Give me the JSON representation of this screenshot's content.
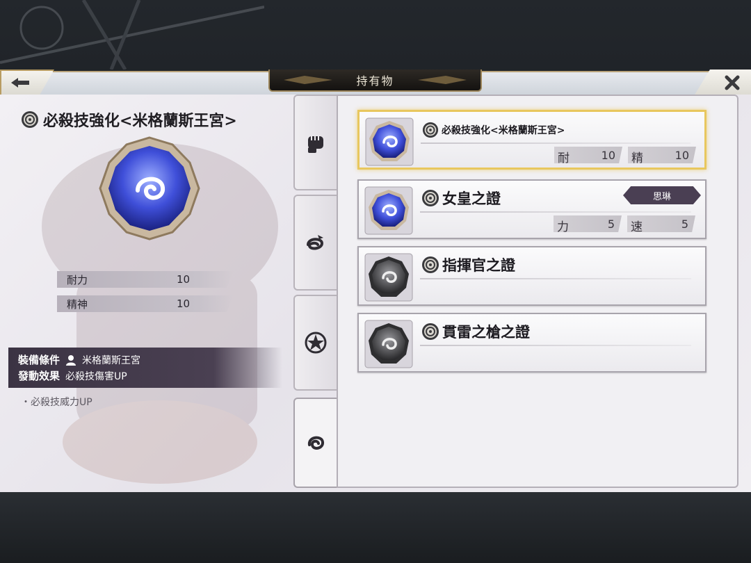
{
  "header": {
    "back_icon": "left-arrow-icon",
    "title": "持有物",
    "close_icon": "close-icon"
  },
  "detail": {
    "name": "必殺技強化<米格蘭斯王宮>",
    "gem_color": "#3f4fd9",
    "stats": [
      {
        "label": "耐力",
        "value": "10"
      },
      {
        "label": "精神",
        "value": "10"
      }
    ],
    "equip_condition_label": "裝備條件",
    "equip_condition_value": "米格蘭斯王宮",
    "effect_label": "發動效果",
    "effect_value": "必殺技傷害UP",
    "passive": "・必殺技威力UP"
  },
  "tabs": [
    {
      "icon": "fist-icon"
    },
    {
      "icon": "dragon-icon"
    },
    {
      "icon": "star-crest-icon"
    },
    {
      "icon": "swirl-icon",
      "active": true
    }
  ],
  "items": [
    {
      "name": "必殺技強化<米格蘭斯王宮>",
      "gem": "blue",
      "selected": true,
      "stats": [
        {
          "label": "耐",
          "value": "10"
        },
        {
          "label": "精",
          "value": "10"
        }
      ]
    },
    {
      "name": "女皇之證",
      "gem": "blue",
      "owner": "思琳",
      "stats": [
        {
          "label": "力",
          "value": "5"
        },
        {
          "label": "速",
          "value": "5"
        }
      ]
    },
    {
      "name": "指揮官之證",
      "gem": "gray"
    },
    {
      "name": "貫雷之槍之證",
      "gem": "gray"
    }
  ],
  "colors": {
    "accent_gold": "#e8c75e",
    "gem_blue": "#3f4fd9",
    "gem_gray": "#555558",
    "condition_bg": "#3b3343"
  }
}
